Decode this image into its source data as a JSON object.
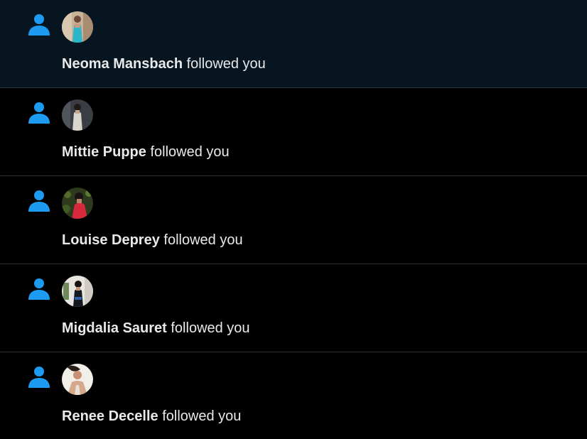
{
  "accent_color": "#1d9bf0",
  "notifications": [
    {
      "icon": "person-icon",
      "name": "Neoma Mansbach",
      "action": "followed you",
      "unread": true
    },
    {
      "icon": "person-icon",
      "name": "Mittie Puppe",
      "action": "followed you",
      "unread": false
    },
    {
      "icon": "person-icon",
      "name": "Louise Deprey",
      "action": "followed you",
      "unread": false
    },
    {
      "icon": "person-icon",
      "name": "Migdalia Sauret",
      "action": "followed you",
      "unread": false
    },
    {
      "icon": "person-icon",
      "name": "Renee Decelle",
      "action": "followed you",
      "unread": false
    }
  ]
}
